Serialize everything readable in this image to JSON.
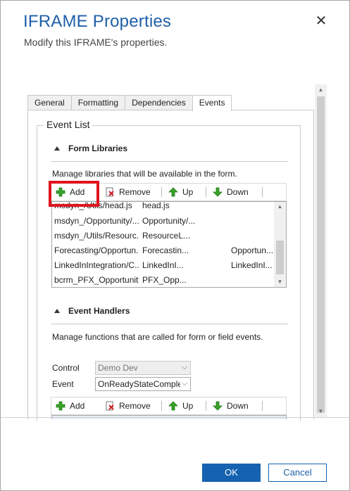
{
  "dialog": {
    "title": "IFRAME Properties",
    "subtitle": "Modify this IFRAME's properties.",
    "close_icon": "close-icon"
  },
  "tabs": [
    {
      "label": "General"
    },
    {
      "label": "Formatting"
    },
    {
      "label": "Dependencies"
    },
    {
      "label": "Events",
      "active": true
    }
  ],
  "event_list": {
    "legend": "Event List",
    "form_libraries": {
      "heading": "Form Libraries",
      "description": "Manage libraries that will be available in the form.",
      "toolbar": {
        "add": "Add",
        "remove": "Remove",
        "up": "Up",
        "down": "Down"
      },
      "rows": [
        {
          "name": "msdyn_/Utils/head.js",
          "display": "head.js",
          "extra": ""
        },
        {
          "name": "msdyn_/Opportunity/...",
          "display": "Opportunity/...",
          "extra": ""
        },
        {
          "name": "msdyn_/Utils/Resourc...",
          "display": "ResourceL...",
          "extra": ""
        },
        {
          "name": "Forecasting/Opportun...",
          "display": "Forecastin...",
          "extra": "Opportun..."
        },
        {
          "name": "LinkedInIntegration/C...",
          "display": "LinkedInI...",
          "extra": "LinkedInI..."
        },
        {
          "name": "bcrm_PFX_Opportunity",
          "display": "PFX_Opp...",
          "extra": ""
        }
      ]
    },
    "event_handlers": {
      "heading": "Event Handlers",
      "description": "Manage functions that are called for form or field events.",
      "control_label": "Control",
      "control_value": "Demo Dev",
      "event_label": "Event",
      "event_value": "OnReadyStateComple",
      "toolbar": {
        "add": "Add",
        "remove": "Remove",
        "up": "Up",
        "down": "Down"
      }
    }
  },
  "footer": {
    "ok": "OK",
    "cancel": "Cancel"
  },
  "colors": {
    "title": "#1f5fa8",
    "primary_button": "#1563b0",
    "highlight": "#e0141e"
  }
}
